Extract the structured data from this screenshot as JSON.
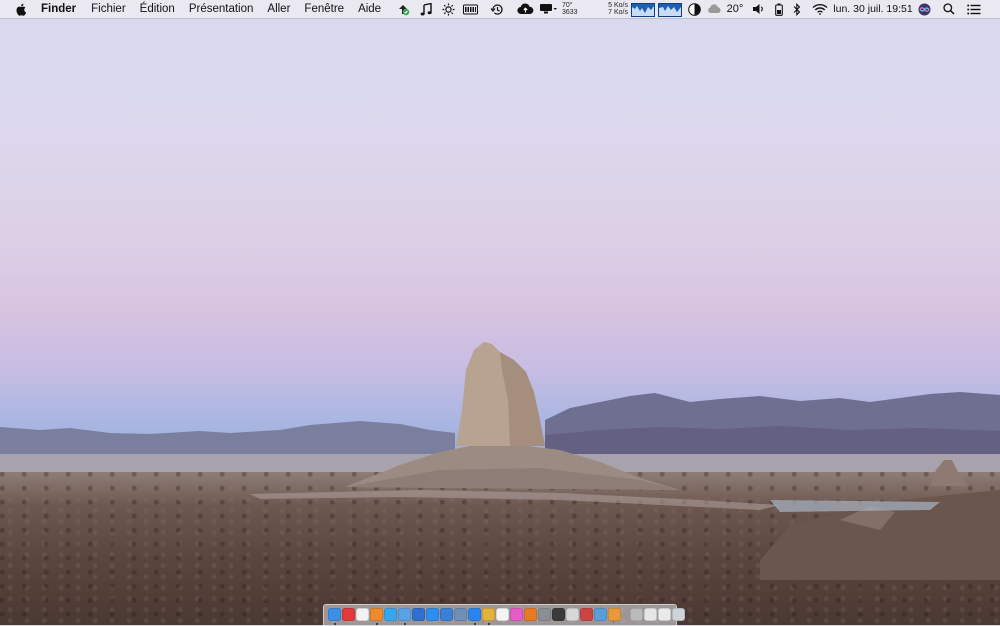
{
  "menubar": {
    "app_name": "Finder",
    "menus": [
      "Fichier",
      "Édition",
      "Présentation",
      "Aller",
      "Fenêtre",
      "Aide"
    ],
    "status": {
      "temperature_label": "70°",
      "fan_speed": "3633",
      "net_up": "5 Ko/s",
      "net_down": "7 Ko/s",
      "weather_temp": "20°",
      "datetime": "lun. 30 juil. 19:51"
    }
  },
  "dock": {
    "apps": [
      {
        "name": "finder",
        "color": "#3b8fe6",
        "running": true
      },
      {
        "name": "no-entry",
        "color": "#e23a3a",
        "running": false
      },
      {
        "name": "calendar",
        "color": "#f2f2f2",
        "running": false
      },
      {
        "name": "cloud-app",
        "color": "#f08a2a",
        "running": true
      },
      {
        "name": "messages",
        "color": "#34a7f0",
        "running": false
      },
      {
        "name": "mail",
        "color": "#5aa2e8",
        "running": true
      },
      {
        "name": "vpn",
        "color": "#2f6fcf",
        "running": false
      },
      {
        "name": "safari",
        "color": "#2d8ef0",
        "running": false
      },
      {
        "name": "xcode",
        "color": "#3a7fd8",
        "running": false
      },
      {
        "name": "preview",
        "color": "#6d8fb8",
        "running": false
      },
      {
        "name": "app-store",
        "color": "#2a84f0",
        "running": true
      },
      {
        "name": "chrome",
        "color": "#e2b33b",
        "running": true
      },
      {
        "name": "text-editor",
        "color": "#f4f4f4",
        "running": false
      },
      {
        "name": "itunes",
        "color": "#e55cc6",
        "running": false
      },
      {
        "name": "firefox",
        "color": "#e77a25",
        "running": false
      },
      {
        "name": "settings",
        "color": "#8a8e96",
        "running": false
      },
      {
        "name": "terminal",
        "color": "#3b3b3b",
        "running": false
      },
      {
        "name": "photos",
        "color": "#d8d8d8",
        "running": false
      },
      {
        "name": "activity",
        "color": "#cc4444",
        "running": false
      },
      {
        "name": "monitor",
        "color": "#5a9ed8",
        "running": false
      },
      {
        "name": "fan",
        "color": "#e89a3a",
        "running": false
      },
      {
        "name": "document",
        "color": "#bbbbbb",
        "running": false
      },
      {
        "name": "downloads",
        "color": "#e6e6e6",
        "running": false
      },
      {
        "name": "folder",
        "color": "#eaeaea",
        "running": false
      },
      {
        "name": "trash",
        "color": "#cfd3d8",
        "running": false
      }
    ]
  }
}
